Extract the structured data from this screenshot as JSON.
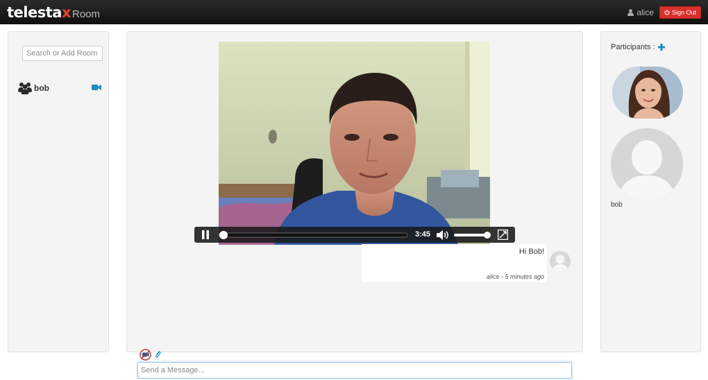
{
  "app": {
    "brand_main": "telestax",
    "brand_sub": "Room"
  },
  "nav": {
    "user": "alice",
    "signout_label": "Sign Out"
  },
  "rooms": {
    "search_placeholder": "Search or Add Room",
    "items": [
      {
        "label": "bob"
      }
    ]
  },
  "video": {
    "time": "3:45",
    "progress": 0.0,
    "volume": 1.0,
    "playing": true
  },
  "chat": {
    "messages": [
      {
        "text": "Hi Bob!",
        "meta": "alice - 5 minutes ago"
      }
    ],
    "composer_placeholder": "Send a Message..."
  },
  "participants": {
    "title": "Participants :",
    "items": [
      {
        "name": ""
      },
      {
        "name": "bob"
      }
    ]
  },
  "colors": {
    "accent": "#1e8bc3",
    "signout": "#d9302c",
    "panel": "#f4f4f4",
    "brand_x": "#e8452c"
  }
}
